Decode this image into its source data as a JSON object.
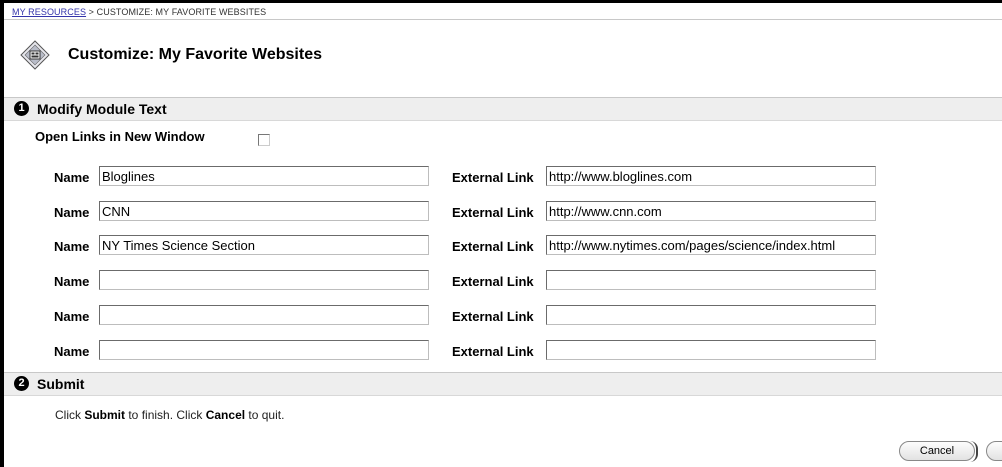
{
  "breadcrumb": {
    "root": "MY RESOURCES",
    "separator": " > ",
    "current": "CUSTOMIZE: MY FAVORITE WEBSITES"
  },
  "page": {
    "title": "Customize: My Favorite Websites"
  },
  "section1": {
    "number": "1",
    "title": "Modify Module Text",
    "open_links_label": "Open Links in New Window",
    "open_links_checked": false
  },
  "labels": {
    "name": "Name",
    "external_link": "External Link"
  },
  "rows": [
    {
      "name": "Bloglines",
      "link": "http://www.bloglines.com"
    },
    {
      "name": "CNN",
      "link": "http://www.cnn.com"
    },
    {
      "name": "NY Times Science Section",
      "link": "http://www.nytimes.com/pages/science/index.html"
    },
    {
      "name": "",
      "link": ""
    },
    {
      "name": "",
      "link": ""
    },
    {
      "name": "",
      "link": ""
    }
  ],
  "section2": {
    "number": "2",
    "title": "Submit",
    "instr_pre": "Click ",
    "instr_submit": "Submit",
    "instr_mid": " to finish. Click ",
    "instr_cancel": "Cancel",
    "instr_post": " to quit."
  },
  "buttons": {
    "cancel": "Cancel",
    "submit": ""
  }
}
